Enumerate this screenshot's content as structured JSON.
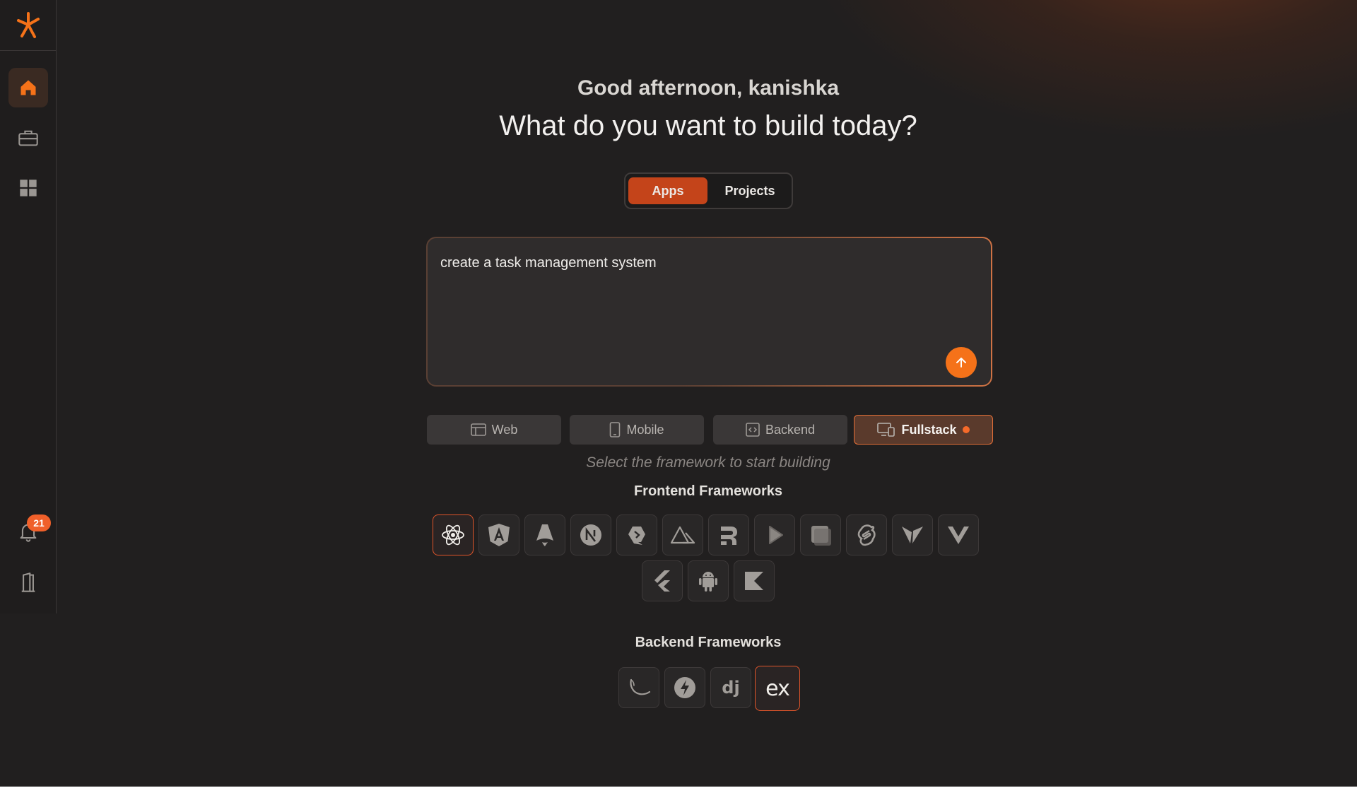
{
  "colors": {
    "accent": "#f57219",
    "accent_dark": "#c4441a",
    "background": "#211f1f",
    "badge": "#f0602a"
  },
  "sidebar": {
    "logo_icon": "asterisk-logo-icon",
    "items": [
      {
        "icon": "home-icon",
        "active": true
      },
      {
        "icon": "briefcase-icon",
        "active": false
      },
      {
        "icon": "grid-icon",
        "active": false
      }
    ],
    "notifications": {
      "icon": "bell-icon",
      "count": "21"
    },
    "exit_icon": "door-exit-icon"
  },
  "header": {
    "greeting": "Good afternoon, kanishka",
    "headline": "What do you want to build today?"
  },
  "mode_toggle": {
    "options": [
      {
        "label": "Apps",
        "selected": true
      },
      {
        "label": "Projects",
        "selected": false
      }
    ]
  },
  "prompt": {
    "value": "create a task management system",
    "send_icon": "arrow-up-icon"
  },
  "platforms": [
    {
      "label": "Web",
      "icon": "browser-icon",
      "selected": false
    },
    {
      "label": "Mobile",
      "icon": "phone-icon",
      "selected": false
    },
    {
      "label": "Backend",
      "icon": "code-window-icon",
      "selected": false
    },
    {
      "label": "Fullstack",
      "icon": "devices-icon",
      "selected": true
    }
  ],
  "hint": "Select the framework to start building",
  "frontend": {
    "title": "Frontend Frameworks",
    "frameworks": [
      {
        "icon": "react-icon",
        "selected": true
      },
      {
        "icon": "angular-icon",
        "selected": false
      },
      {
        "icon": "astro-icon",
        "selected": false
      },
      {
        "icon": "nextjs-icon",
        "selected": false
      },
      {
        "icon": "qwik-icon",
        "selected": false
      },
      {
        "icon": "nuxt-icon",
        "selected": false
      },
      {
        "icon": "remix-icon",
        "selected": false
      },
      {
        "icon": "slidev-icon",
        "selected": false
      },
      {
        "icon": "shadcn-icon",
        "selected": false
      },
      {
        "icon": "svelte-icon",
        "selected": false
      },
      {
        "icon": "vite-icon",
        "selected": false
      },
      {
        "icon": "vue-icon",
        "selected": false
      },
      {
        "icon": "flutter-icon",
        "selected": false
      },
      {
        "icon": "android-icon",
        "selected": false
      },
      {
        "icon": "kotlin-icon",
        "selected": false
      }
    ]
  },
  "backend": {
    "title": "Backend Frameworks",
    "frameworks": [
      {
        "icon": "flask-icon",
        "selected": false
      },
      {
        "icon": "fastapi-icon",
        "selected": false
      },
      {
        "icon": "django-icon",
        "label": "dj",
        "selected": false
      },
      {
        "icon": "express-icon",
        "label": "ex",
        "selected": true
      }
    ]
  }
}
